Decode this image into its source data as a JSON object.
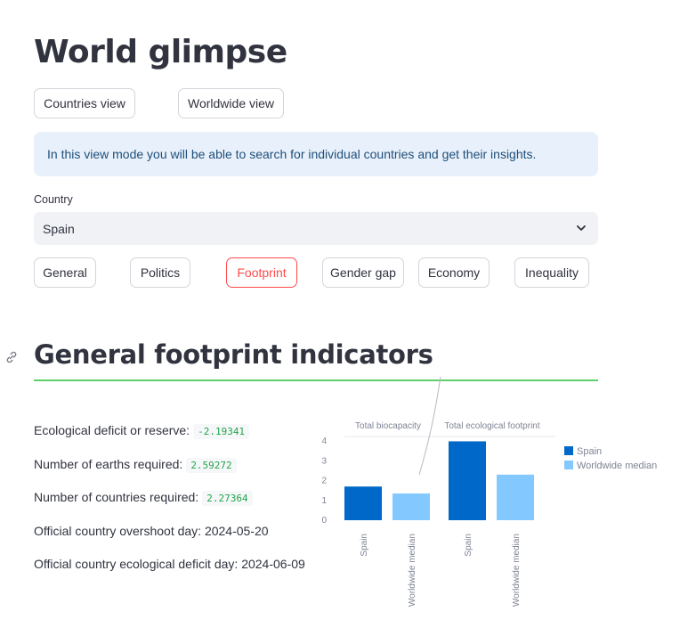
{
  "page": {
    "title": "World glimpse"
  },
  "view_modes": [
    "Countries view",
    "Worldwide view"
  ],
  "info_text": "In this view mode you will be able to search for individual countries and get their insights.",
  "country_select": {
    "label": "Country",
    "value": "Spain"
  },
  "tabs": [
    {
      "label": "General",
      "active": false
    },
    {
      "label": "Politics",
      "active": false
    },
    {
      "label": "Footprint",
      "active": true
    },
    {
      "label": "Gender gap",
      "active": false
    },
    {
      "label": "Economy",
      "active": false
    },
    {
      "label": "Inequality",
      "active": false
    }
  ],
  "section_title": "General footprint indicators",
  "metrics": [
    {
      "label": "Ecological deficit or reserve:",
      "value": "-2.19341"
    },
    {
      "label": "Number of earths required:",
      "value": "2.59272"
    },
    {
      "label": "Number of countries required:",
      "value": "2.27364"
    },
    {
      "label": "Official country overshoot day: 2024-05-20",
      "value": ""
    },
    {
      "label": "Official country ecological deficit day: 2024-06-09",
      "value": ""
    }
  ],
  "colors": {
    "accent": "#ff4b4b",
    "spain": "#0068c9",
    "median": "#83c9ff",
    "divider": "#5fd068"
  },
  "chart_data": {
    "type": "bar",
    "facets": [
      "Total biocapacity",
      "Total ecological footprint"
    ],
    "categories": [
      "Spain",
      "Worldwide median"
    ],
    "series": [
      {
        "name": "Spain",
        "values": [
          1.7,
          3.98
        ]
      },
      {
        "name": "Worldwide median",
        "values": [
          1.35,
          2.3
        ]
      }
    ],
    "yticks": [
      0,
      1,
      2,
      3,
      4
    ],
    "ylim": [
      0,
      4
    ],
    "legend": [
      "Spain",
      "Worldwide median"
    ],
    "legend_position": "right"
  }
}
